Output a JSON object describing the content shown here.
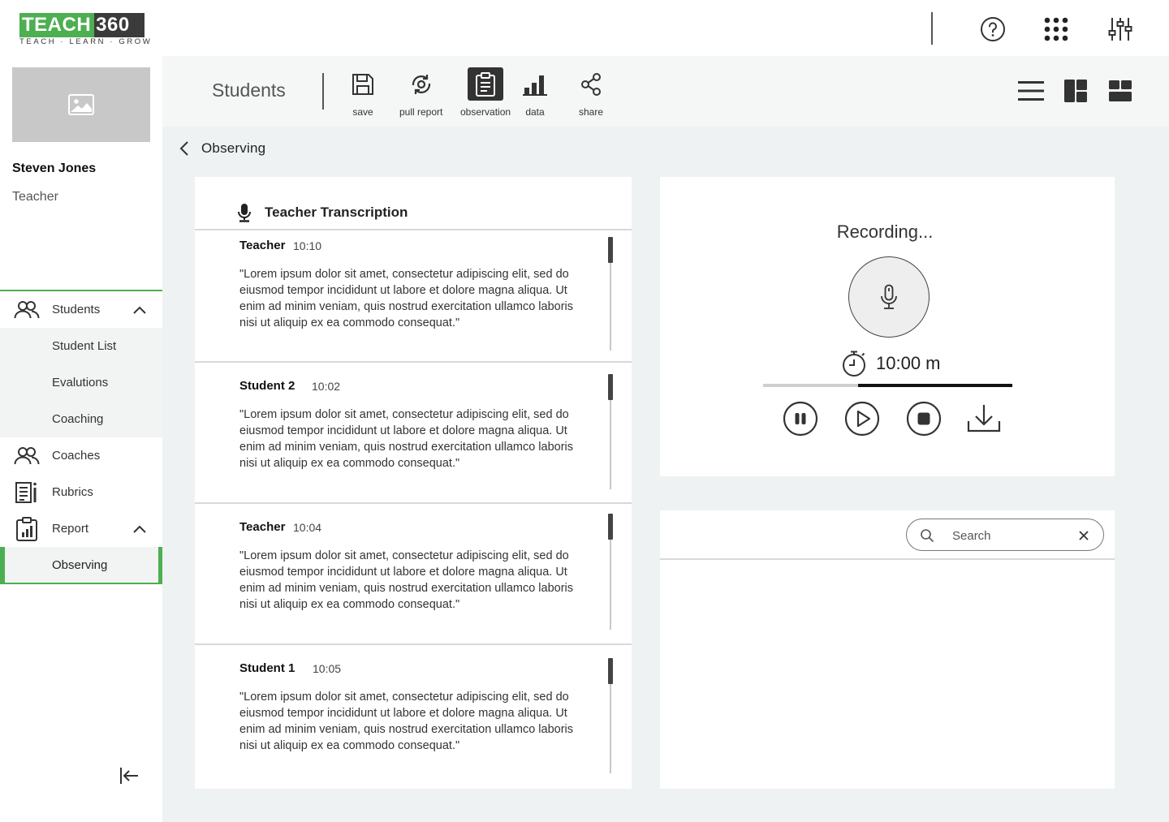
{
  "brand": {
    "logo_part1": "TEACH",
    "logo_part2": "360",
    "tagline": "TEACH · LEARN · GROW"
  },
  "topbar": {
    "icons": [
      "help-icon",
      "apps-grid-icon",
      "settings-sliders-icon"
    ]
  },
  "user": {
    "name": "Steven Jones",
    "role": "Teacher"
  },
  "sidebar": {
    "students": {
      "label": "Students",
      "items": [
        "Student List",
        "Evalutions",
        "Coaching"
      ]
    },
    "coaches": "Coaches",
    "rubrics": "Rubrics",
    "report": {
      "label": "Report",
      "items": [
        "Observing"
      ]
    }
  },
  "toolbar": {
    "title": "Students",
    "buttons": {
      "save": "save",
      "pull_report": "pull report",
      "observation": "observation",
      "data": "data",
      "share": "share"
    },
    "active": "observation"
  },
  "breadcrumb": {
    "label": "Observing"
  },
  "transcription": {
    "title": "Teacher Transcription",
    "entries": [
      {
        "speaker": "Teacher",
        "time": "10:10",
        "text": "\"Lorem ipsum dolor sit amet, consectetur adipiscing elit, sed do eiusmod tempor incididunt ut labore et dolore magna aliqua. Ut enim ad minim veniam, quis nostrud exercitation ullamco laboris nisi ut aliquip ex ea commodo consequat.\""
      },
      {
        "speaker": "Student 2",
        "time": "10:02",
        "text": "\"Lorem ipsum dolor sit amet, consectetur adipiscing elit, sed do eiusmod tempor incididunt ut labore et dolore magna aliqua. Ut enim ad minim veniam, quis nostrud exercitation ullamco laboris nisi ut aliquip ex ea commodo consequat.\""
      },
      {
        "speaker": "Teacher",
        "time": "10:04",
        "text": "\"Lorem ipsum dolor sit amet, consectetur adipiscing elit, sed do eiusmod tempor incididunt ut labore et dolore magna aliqua. Ut enim ad minim veniam, quis nostrud exercitation ullamco laboris nisi ut aliquip ex ea commodo consequat.\""
      },
      {
        "speaker": "Student 1",
        "time": "10:05",
        "text": "\"Lorem ipsum dolor sit amet, consectetur adipiscing elit, sed do eiusmod tempor incididunt ut labore et dolore magna aliqua. Ut enim ad minim veniam, quis nostrud exercitation ullamco laboris nisi ut aliquip ex ea commodo consequat.\""
      }
    ]
  },
  "recorder": {
    "status": "Recording...",
    "timer": "10:00 m",
    "progress_fraction": 0.38
  },
  "search": {
    "placeholder": "Search",
    "value": ""
  },
  "colors": {
    "accent": "#4caf50",
    "logo_dark": "#3b3b3b",
    "active_tool": "#333333"
  }
}
